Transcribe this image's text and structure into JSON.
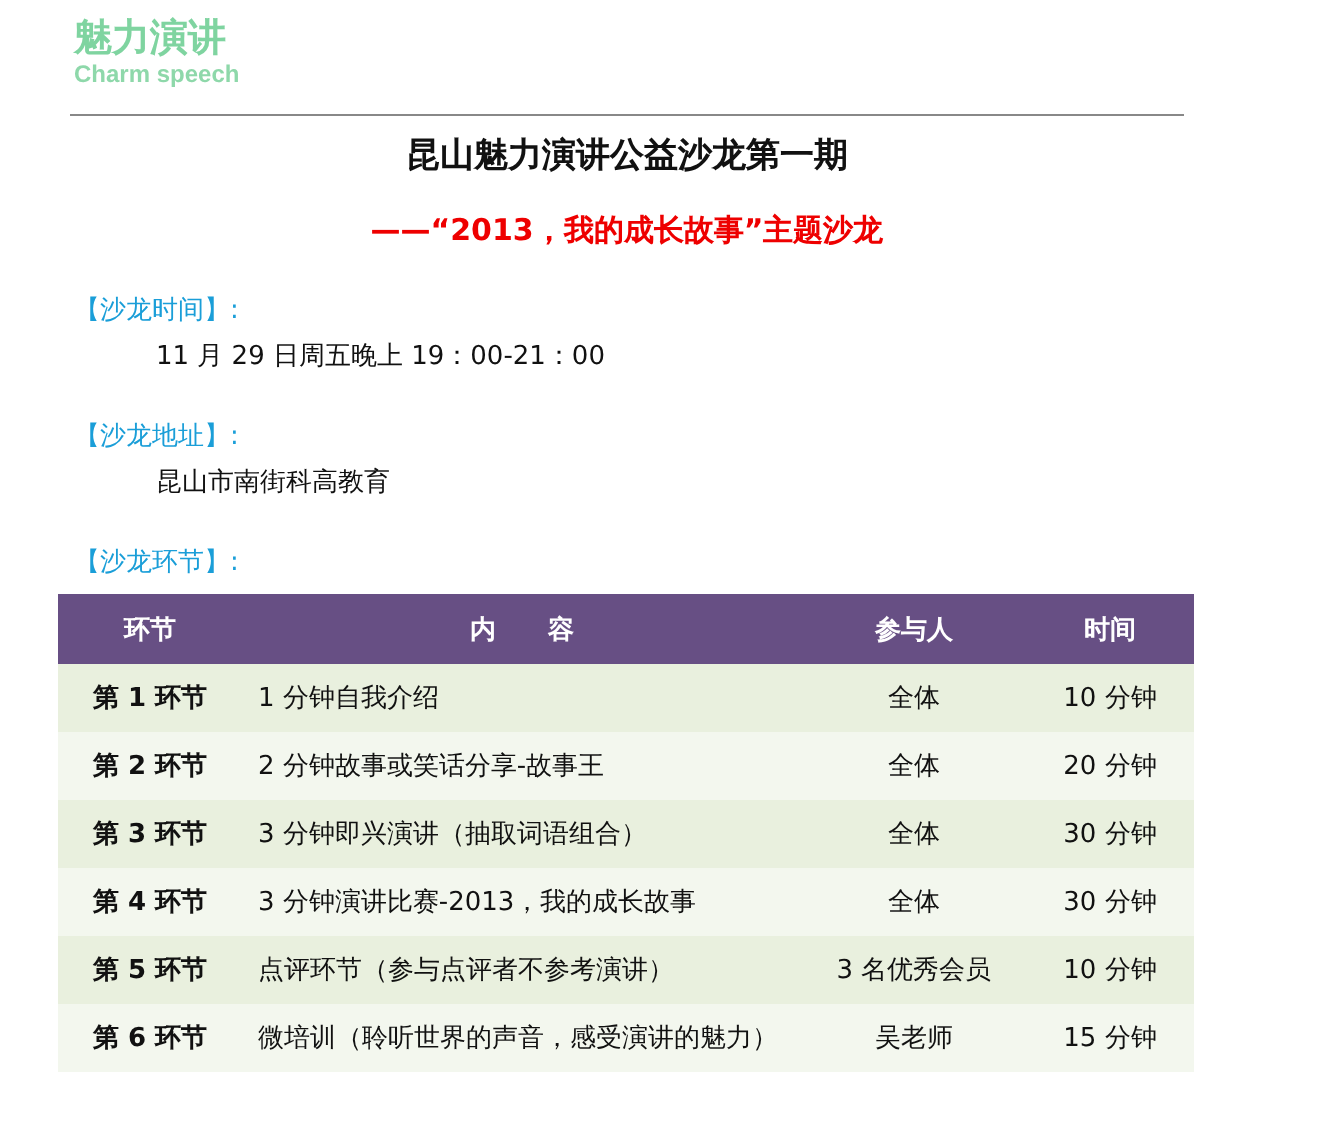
{
  "logo": {
    "title": "魅力演讲",
    "subtitle": "Charm speech"
  },
  "title": "昆山魅力演讲公益沙龙第一期",
  "subtitle": "——“2013，我的成长故事”主题沙龙",
  "sections": [
    {
      "label": "【沙龙时间】:",
      "value": "11 月 29 日周五晚上 19：00-21：00"
    },
    {
      "label": "【沙龙地址】:",
      "value": "昆山市南街科高教育"
    },
    {
      "label": "【沙龙环节】:"
    }
  ],
  "table": {
    "columns": [
      "环节",
      "内　　容",
      "参与人",
      "时间"
    ],
    "rows": [
      [
        "第 1 环节",
        "1 分钟自我介绍",
        "全体",
        "10 分钟"
      ],
      [
        "第 2 环节",
        "2 分钟故事或笑话分享-故事王",
        "全体",
        "20 分钟"
      ],
      [
        "第 3 环节",
        "3 分钟即兴演讲（抽取词语组合）",
        "全体",
        "30 分钟"
      ],
      [
        "第 4 环节",
        "3 分钟演讲比赛-2013，我的成长故事",
        "全体",
        "30 分钟"
      ],
      [
        "第 5 环节",
        "点评环节（参与点评者不参考演讲）",
        "3 名优秀会员",
        "10 分钟"
      ],
      [
        "第 6 环节",
        "微培训（聆听世界的声音，感受演讲的魅力）",
        "吴老师",
        "15 分钟"
      ]
    ]
  }
}
